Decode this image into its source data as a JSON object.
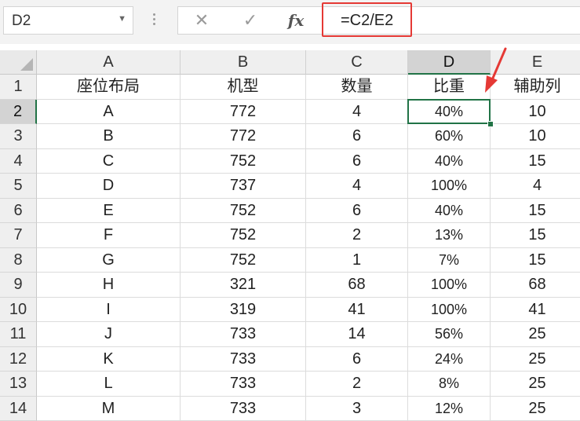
{
  "formula_bar": {
    "name_box": "D2",
    "cancel_icon": "close-icon",
    "enter_icon": "check-icon",
    "function_label": "fx",
    "formula": "=C2/E2",
    "highlight_color": "#e53935"
  },
  "columns": [
    "A",
    "B",
    "C",
    "D",
    "E"
  ],
  "selected_column": "D",
  "header_row": [
    "座位布局",
    "机型",
    "数量",
    "比重",
    "辅助列"
  ],
  "rows": [
    {
      "num": "2",
      "cells": [
        "A",
        "772",
        "4",
        "40%",
        "10"
      ]
    },
    {
      "num": "3",
      "cells": [
        "B",
        "772",
        "6",
        "60%",
        "10"
      ]
    },
    {
      "num": "4",
      "cells": [
        "C",
        "752",
        "6",
        "40%",
        "15"
      ]
    },
    {
      "num": "5",
      "cells": [
        "D",
        "737",
        "4",
        "100%",
        "4"
      ]
    },
    {
      "num": "6",
      "cells": [
        "E",
        "752",
        "6",
        "40%",
        "15"
      ]
    },
    {
      "num": "7",
      "cells": [
        "F",
        "752",
        "2",
        "13%",
        "15"
      ]
    },
    {
      "num": "8",
      "cells": [
        "G",
        "752",
        "1",
        "7%",
        "15"
      ]
    },
    {
      "num": "9",
      "cells": [
        "H",
        "321",
        "68",
        "100%",
        "68"
      ]
    },
    {
      "num": "10",
      "cells": [
        "I",
        "319",
        "41",
        "100%",
        "41"
      ]
    },
    {
      "num": "11",
      "cells": [
        "J",
        "733",
        "14",
        "56%",
        "25"
      ]
    },
    {
      "num": "12",
      "cells": [
        "K",
        "733",
        "6",
        "24%",
        "25"
      ]
    },
    {
      "num": "13",
      "cells": [
        "L",
        "733",
        "2",
        "8%",
        "25"
      ]
    },
    {
      "num": "14",
      "cells": [
        "M",
        "733",
        "3",
        "12%",
        "25"
      ]
    }
  ],
  "active_cell": "D2",
  "accent_color": "#217346",
  "annotation_arrow_color": "#e53935"
}
